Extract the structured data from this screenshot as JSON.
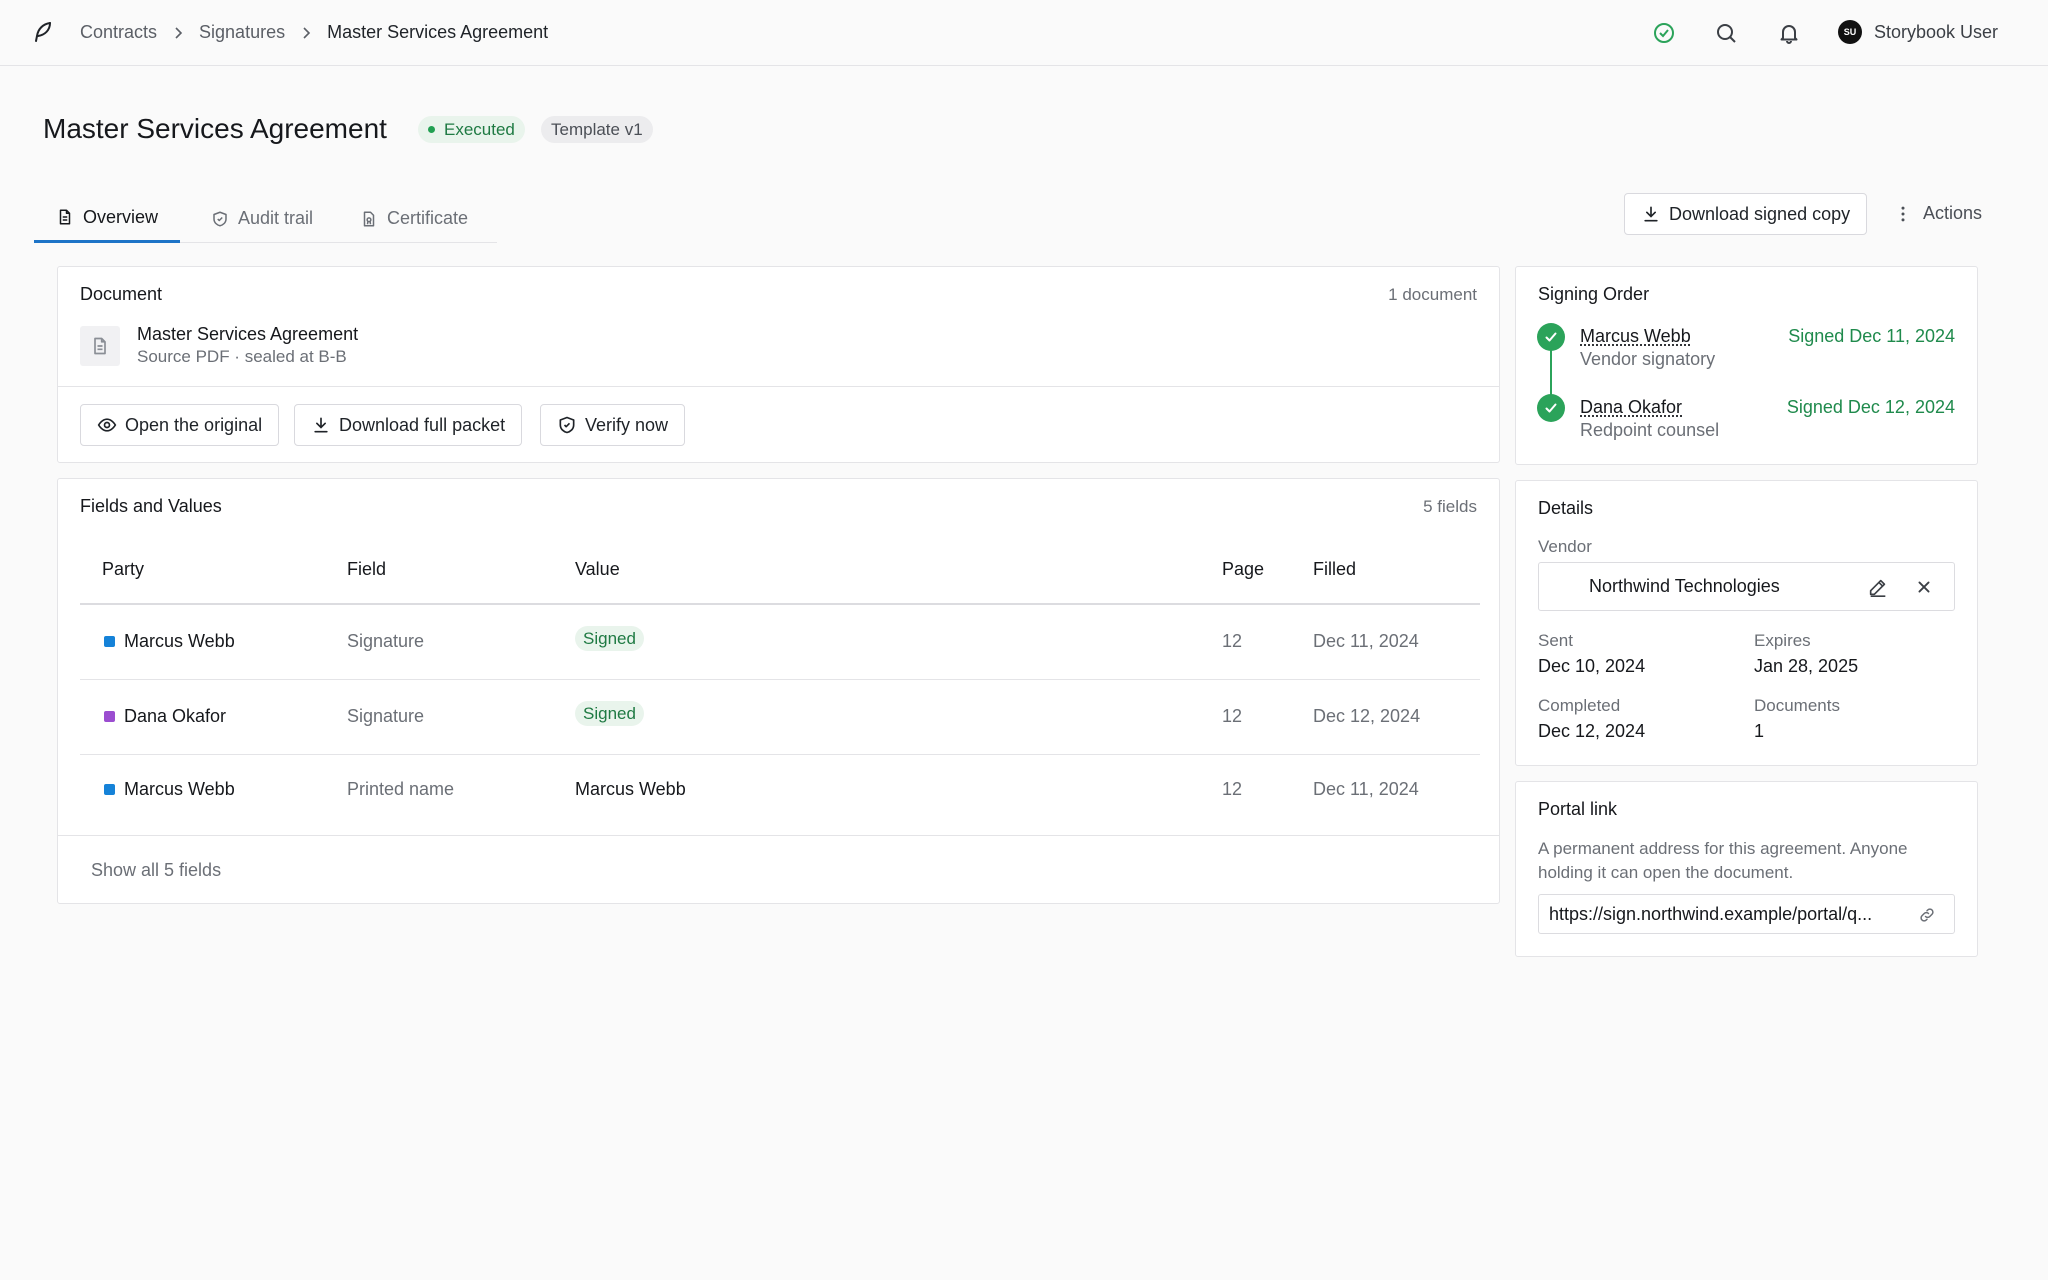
{
  "topbar": {
    "breadcrumbs": [
      "Contracts",
      "Signatures",
      "Master Services Agreement"
    ],
    "user_initials": "SU",
    "user_name": "Storybook User"
  },
  "page": {
    "title": "Master Services Agreement",
    "status_badge": "Executed",
    "template_badge": "Template v1"
  },
  "tabs": [
    {
      "label": "Overview",
      "icon": "document-icon",
      "active": true
    },
    {
      "label": "Audit trail",
      "icon": "shield-check-icon",
      "active": false
    },
    {
      "label": "Certificate",
      "icon": "certificate-icon",
      "active": false
    }
  ],
  "toolbar": {
    "download_signed_label": "Download signed copy",
    "actions_label": "Actions"
  },
  "document_card": {
    "title": "Document",
    "count": "1 document",
    "doc_name": "Master Services Agreement",
    "doc_sub": "Source PDF · sealed at B-B",
    "buttons": [
      "Open the original",
      "Download full packet",
      "Verify now"
    ]
  },
  "fields_card": {
    "title": "Fields and Values",
    "count": "5 fields",
    "columns": [
      "Party",
      "Field",
      "Value",
      "Page",
      "Filled"
    ],
    "rows": [
      {
        "party": "Marcus Webb",
        "party_color": "#1582d8",
        "field": "Signature",
        "value": "Signed",
        "value_is_badge": true,
        "page": "12",
        "filled": "Dec 11, 2024"
      },
      {
        "party": "Dana Okafor",
        "party_color": "#9b4dd0",
        "field": "Signature",
        "value": "Signed",
        "value_is_badge": true,
        "page": "12",
        "filled": "Dec 12, 2024"
      },
      {
        "party": "Marcus Webb",
        "party_color": "#1582d8",
        "field": "Printed name",
        "value": "Marcus Webb",
        "value_is_badge": false,
        "page": "12",
        "filled": "Dec 11, 2024"
      }
    ],
    "show_all_label": "Show all 5 fields"
  },
  "signing_order": {
    "title": "Signing Order",
    "signers": [
      {
        "name": "Marcus Webb",
        "role": "Vendor signatory",
        "status": "Signed Dec 11, 2024"
      },
      {
        "name": "Dana Okafor",
        "role": "Redpoint counsel",
        "status": "Signed Dec 12, 2024"
      }
    ]
  },
  "details": {
    "title": "Details",
    "vendor_label": "Vendor",
    "vendor_value": "Northwind Technologies",
    "sent_label": "Sent",
    "sent_value": "Dec 10, 2024",
    "expires_label": "Expires",
    "expires_value": "Jan 28, 2025",
    "completed_label": "Completed",
    "completed_value": "Dec 12, 2024",
    "documents_label": "Documents",
    "documents_value": "1"
  },
  "portal": {
    "title": "Portal link",
    "description": "A permanent address for this agreement. Anyone holding it can open the document.",
    "url": "https://sign.northwind.example/portal/q..."
  },
  "colors": {
    "accent": "#1d74c7",
    "success": "#2ba35a",
    "success_text": "#1f8a4c"
  }
}
